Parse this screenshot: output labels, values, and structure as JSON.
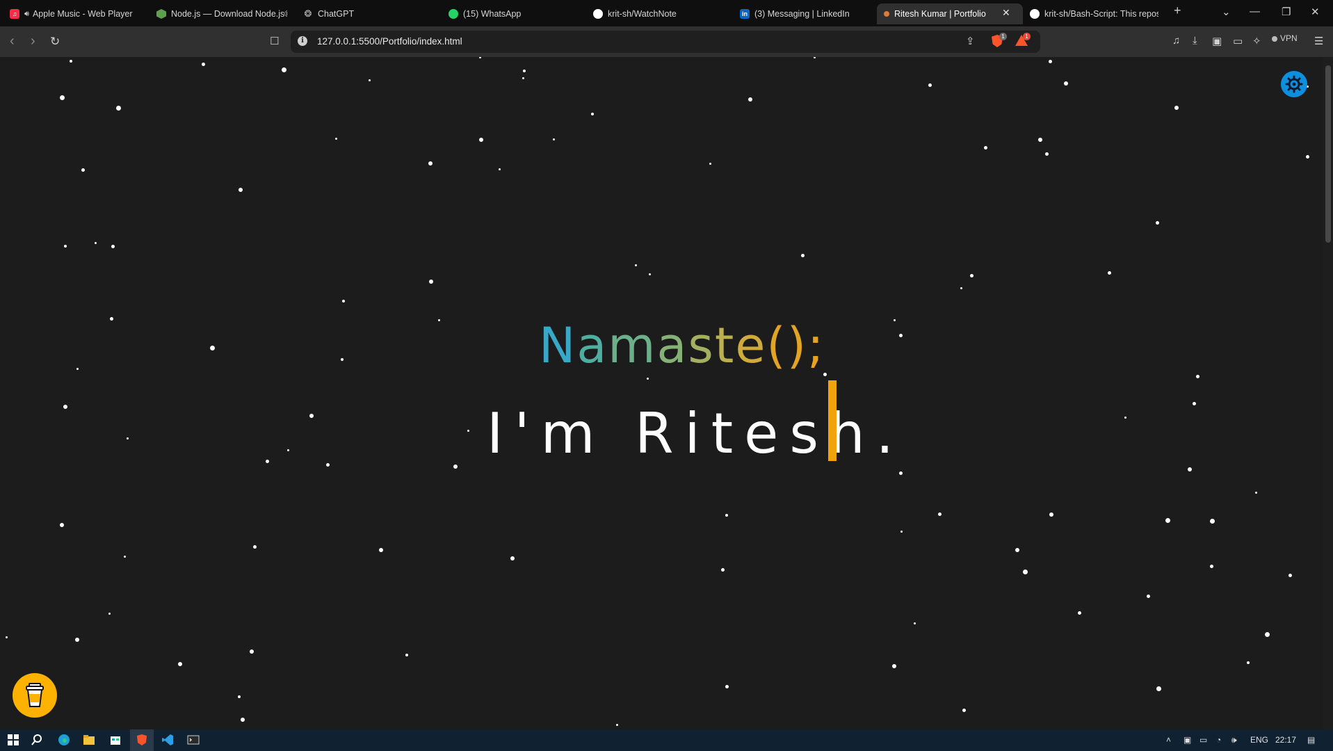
{
  "browser": {
    "tabs": [
      {
        "label": "Apple Music - Web Player",
        "color": "#fa2d48"
      },
      {
        "label": "Node.js — Download Node.js®",
        "color": "#5fa04e"
      },
      {
        "label": "ChatGPT",
        "color": "#9a9a9a"
      },
      {
        "label": "(15) WhatsApp",
        "color": "#25d366"
      },
      {
        "label": "krit-sh/WatchNote",
        "color": "#ffffff"
      },
      {
        "label": "(3) Messaging | LinkedIn",
        "color": "#0a66c2"
      },
      {
        "label": "Ritesh Kumar | Portfolio",
        "color": "#e07a3a"
      },
      {
        "label": "krit-sh/Bash-Script: This repos...",
        "color": "#ffffff"
      }
    ],
    "active_tab_index": 6,
    "address": "127.0.0.1:5500/Portfolio/index.html",
    "shield_badge": "1",
    "rewards_badge": "1",
    "vpn_label": "VPN"
  },
  "hero": {
    "greeting": [
      "N",
      "a",
      "m",
      "a",
      "s",
      "t",
      "e",
      "()",
      ";"
    ],
    "intro": "I'm Ritesh."
  },
  "taskbar": {
    "language": "ENG",
    "time": "22:17"
  },
  "colors": {
    "background": "#1c1c1c",
    "cursor": "#f0a40b",
    "theme_button": "#0d8fe0",
    "coffee_button": "#fdb100"
  }
}
